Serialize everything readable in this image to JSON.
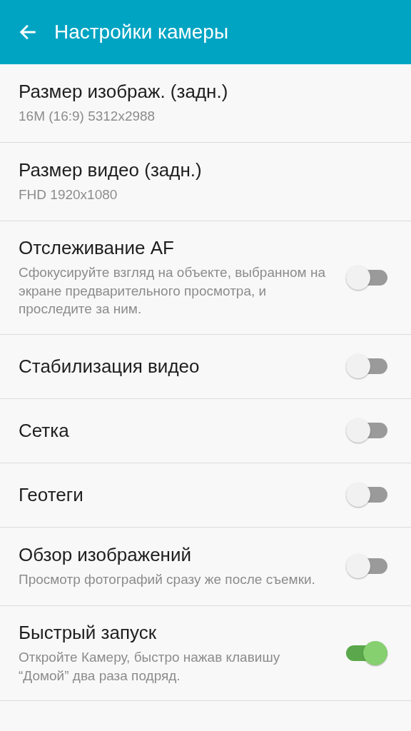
{
  "header": {
    "title": "Настройки камеры"
  },
  "settings": [
    {
      "kind": "value",
      "title": "Размер изображ. (задн.)",
      "subtitle": "16M (16:9) 5312x2988"
    },
    {
      "kind": "value",
      "title": "Размер видео (задн.)",
      "subtitle": "FHD 1920x1080"
    },
    {
      "kind": "toggle",
      "title": "Отслеживание AF",
      "subtitle": "Сфокусируйте взгляд на объекте, выбранном на экране предварительного просмотра, и проследите за ним.",
      "on": false
    },
    {
      "kind": "toggle",
      "title": "Стабилизация видео",
      "on": false
    },
    {
      "kind": "toggle",
      "title": "Сетка",
      "on": false
    },
    {
      "kind": "toggle",
      "title": "Геотеги",
      "on": false
    },
    {
      "kind": "toggle",
      "title": "Обзор изображений",
      "subtitle": "Просмотр фотографий сразу же после съемки.",
      "on": false
    },
    {
      "kind": "toggle",
      "title": "Быстрый запуск",
      "subtitle": "Откройте Камеру, быстро нажав клавишу “Домой” два раза подряд.",
      "on": true
    }
  ]
}
